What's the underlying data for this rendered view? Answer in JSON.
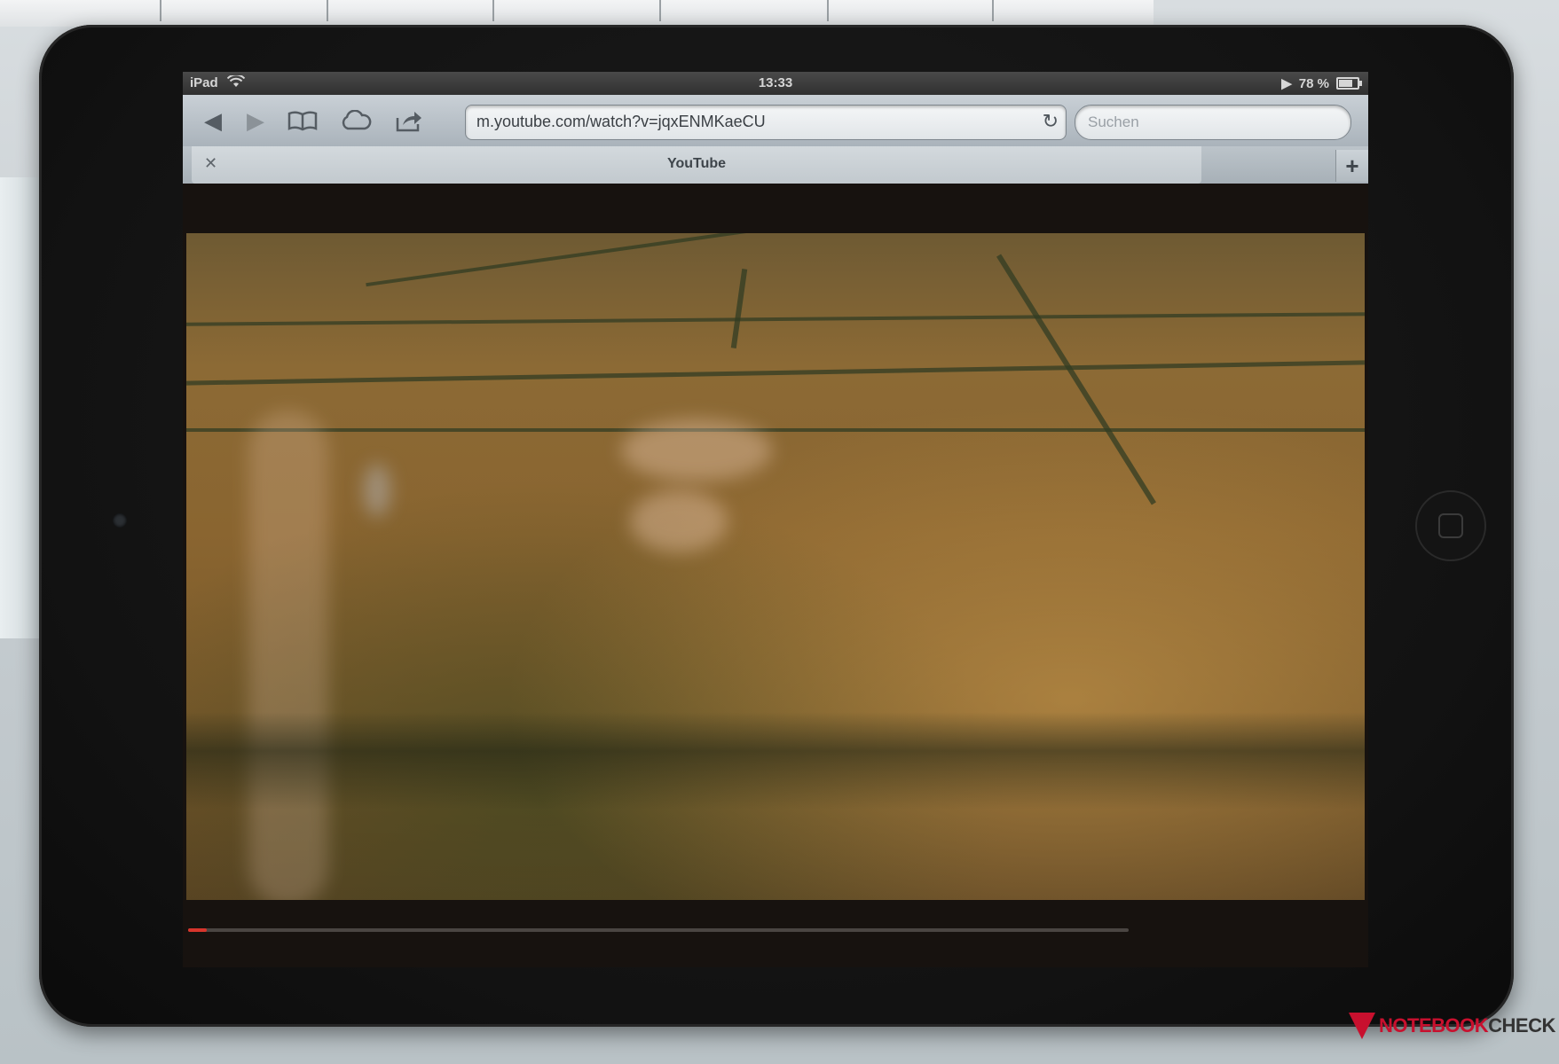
{
  "status_bar": {
    "device_name": "iPad",
    "wifi_icon": "wifi-icon",
    "time": "13:33",
    "location_icon": "location-arrow-icon",
    "battery_percent": "78 %"
  },
  "toolbar": {
    "back_icon": "back-arrow-icon",
    "forward_icon": "forward-arrow-icon",
    "bookmarks_icon": "bookmarks-book-icon",
    "icloud_icon": "icloud-tabs-icon",
    "share_icon": "share-icon",
    "url": "m.youtube.com/watch?v=jqxENMKaeCU",
    "reload_icon": "reload-icon",
    "search_placeholder": "Suchen"
  },
  "tabs": [
    {
      "title": "YouTube",
      "active": true
    }
  ],
  "new_tab_label": "+",
  "video": {
    "progress": 0.02
  },
  "watermark": {
    "brand": "NOTEBOOKCHECK",
    "brand_red": "NOTEBOOK",
    "brand_dark": "CHECK"
  }
}
